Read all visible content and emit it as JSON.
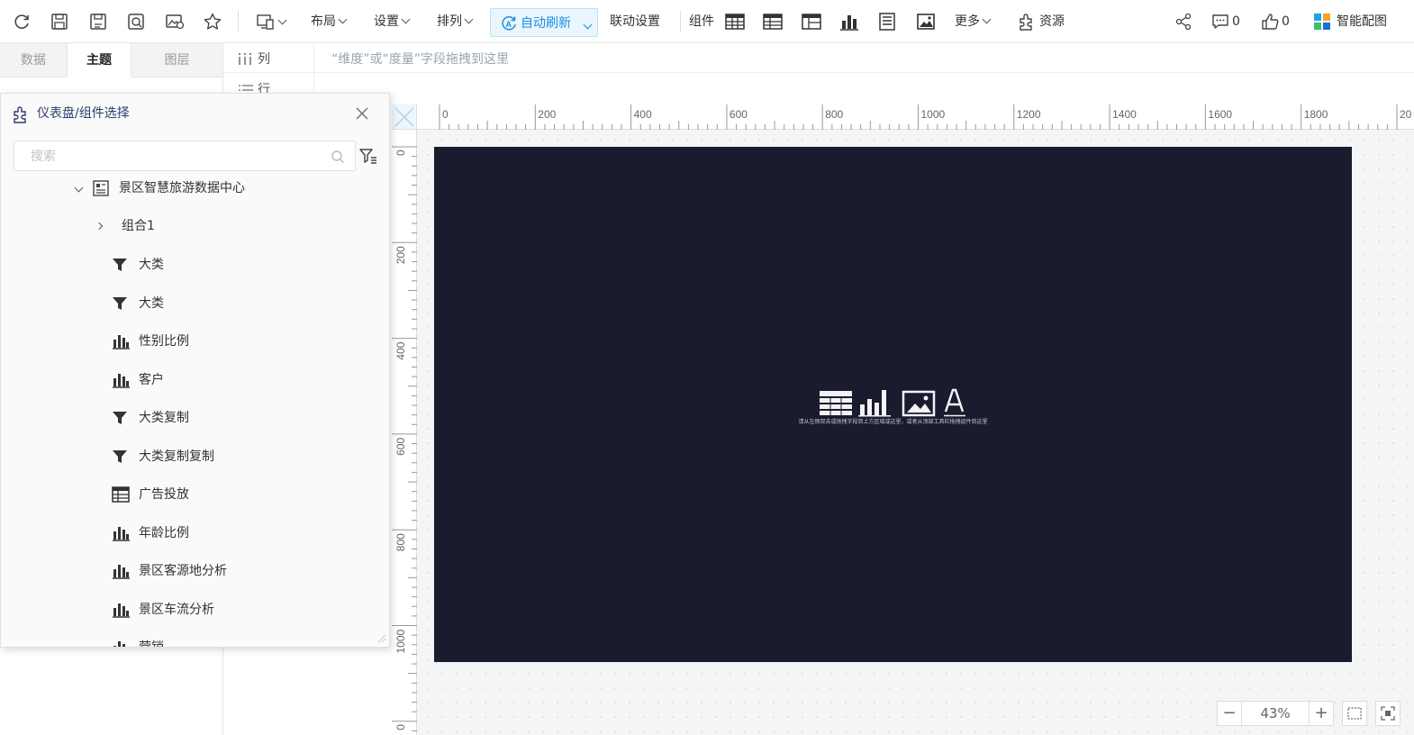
{
  "toolbar": {
    "layout": "布局",
    "settings": "设置",
    "arrange": "排列",
    "auto_refresh": "自动刷新",
    "linkage": "联动设置",
    "components": "组件",
    "more": "更多",
    "resources": "资源",
    "comments_count": "0",
    "likes_count": "0",
    "smart_color": "智能配图"
  },
  "left_tabs": [
    "数据",
    "主题",
    "图层"
  ],
  "fields": {
    "columns": "列",
    "rows": "行",
    "drop_hint": "“维度”或“度量”字段拖拽到这里"
  },
  "picker": {
    "title": "仪表盘/组件选择",
    "search_placeholder": "搜索",
    "root": "景区智慧旅游数据中心",
    "group": "组合1",
    "items": [
      {
        "label": "大类",
        "icon": "filter-icon"
      },
      {
        "label": "大类",
        "icon": "filter-icon"
      },
      {
        "label": "性别比例",
        "icon": "bar-chart-icon"
      },
      {
        "label": "客户",
        "icon": "bar-chart-icon"
      },
      {
        "label": "大类复制",
        "icon": "filter-icon"
      },
      {
        "label": "大类复制复制",
        "icon": "filter-icon"
      },
      {
        "label": "广告投放",
        "icon": "table-icon"
      },
      {
        "label": "年龄比例",
        "icon": "bar-chart-icon"
      },
      {
        "label": "景区客源地分析",
        "icon": "bar-chart-icon"
      },
      {
        "label": "景区车流分析",
        "icon": "bar-chart-icon"
      },
      {
        "label": "营销",
        "icon": "bar-chart-icon"
      }
    ]
  },
  "ruler": {
    "horizontal": [
      "0",
      "200",
      "400",
      "600",
      "800",
      "1000",
      "1200",
      "1400",
      "1600",
      "1800",
      "20"
    ],
    "vertical": [
      "0",
      "200",
      "400",
      "600",
      "800",
      "1000",
      "0"
    ]
  },
  "canvas": {
    "background": "#1a1b2e",
    "empty_hint": "请从左侧双击或拖拽字段到上方区域或这里，或者从顶部工具栏拖拽组件到这里"
  },
  "zoom": {
    "minus": "−",
    "value": "43%",
    "plus": "+"
  }
}
